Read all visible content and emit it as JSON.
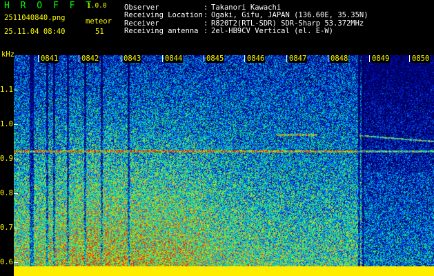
{
  "header": {
    "brand": "H R O F F T",
    "version": "1.0.0",
    "filename": "2511040840.png",
    "datetime": "25.11.04 08:40",
    "type_label": "meteor",
    "count": "51"
  },
  "meta": [
    {
      "key": "Observer",
      "value": "Takanori Kawachi"
    },
    {
      "key": "Receiving Location",
      "value": "Ogaki, Gifu, JAPAN (136.60E, 35.35N)"
    },
    {
      "key": "Receiver",
      "value": "R820T2(RTL-SDR) SDR-Sharp 53.372MHz"
    },
    {
      "key": "Receiving antenna",
      "value": "2el-HB9CV Vertical (el. E-W)"
    }
  ],
  "axes": {
    "y_unit": "kHz",
    "x_ticks": [
      "0841",
      "0842",
      "0843",
      "0844",
      "0845",
      "0846",
      "0847",
      "0848",
      "0849",
      "0850"
    ],
    "y_ticks": [
      "1.1",
      "1.0",
      "0.9",
      "0.8",
      "0.7",
      "0.6"
    ]
  },
  "colors": {
    "background": "#000000",
    "text_yellow": "#ffff00",
    "text_green": "#00ff00",
    "text_white": "#ffffff"
  }
}
